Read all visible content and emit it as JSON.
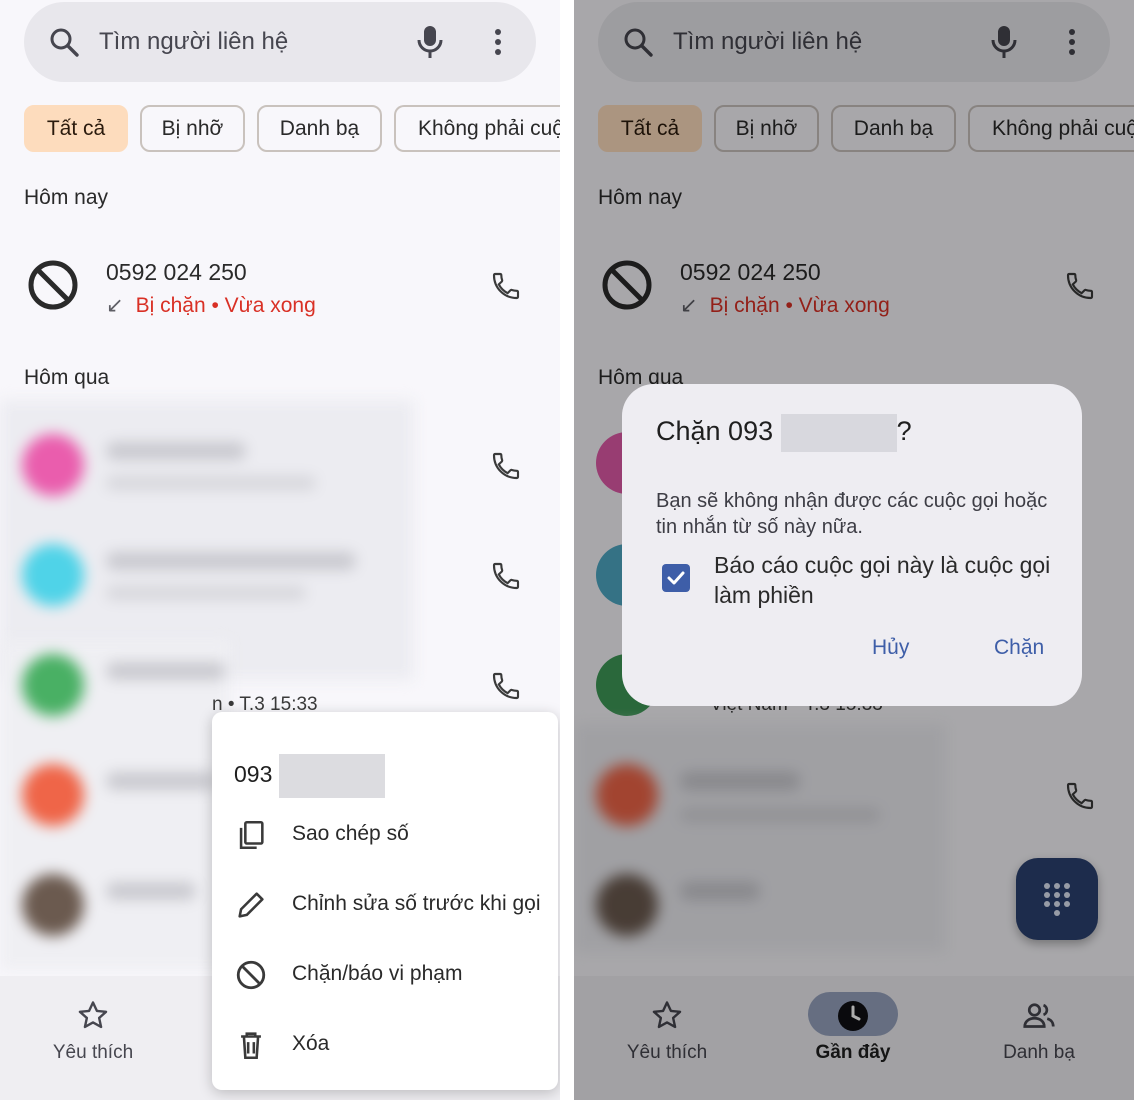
{
  "search": {
    "placeholder": "Tìm người liên hệ"
  },
  "filters": [
    "Tất cả",
    "Bị nhỡ",
    "Danh bạ",
    "Không phải cuộ"
  ],
  "sections": {
    "today": "Hôm nay",
    "yesterday": "Hôm qua"
  },
  "blocked_call": {
    "number": "0592 024 250",
    "status": "Bị chặn • Vừa xong",
    "direction_glyph": "↙"
  },
  "peek_text": "n • T.3 15:33",
  "context_menu": {
    "number_prefix": "093",
    "items": [
      {
        "label": "Sao chép số",
        "icon": "copy-icon"
      },
      {
        "label": "Chỉnh sửa số trước khi gọi",
        "icon": "edit-icon"
      },
      {
        "label": "Chặn/báo vi phạm",
        "icon": "block-icon"
      },
      {
        "label": "Xóa",
        "icon": "delete-icon"
      }
    ]
  },
  "dialog": {
    "title_prefix": "Chặn 093",
    "title_suffix": "?",
    "body": "Bạn sẽ không nhận được các cuộc gọi hoặc tin nhắn từ số này nữa.",
    "checkbox_label": "Báo cáo cuộc gọi này là cuộc gọi làm phiền",
    "checkbox_checked": true,
    "cancel": "Hủy",
    "confirm": "Chặn"
  },
  "right_peek_text": "Việt Nam • T.3 15:33",
  "bottom_nav": [
    {
      "label": "Yêu thích",
      "icon": "star-icon"
    },
    {
      "label": "Gần đây",
      "icon": "clock-icon",
      "active": true
    },
    {
      "label": "Danh bạ",
      "icon": "contacts-icon"
    }
  ],
  "colors": {
    "accent_chip": "#fddcbd",
    "blocked_red": "#d93025",
    "primary_blue": "#3e5ea8",
    "fab": "#2b4170"
  }
}
